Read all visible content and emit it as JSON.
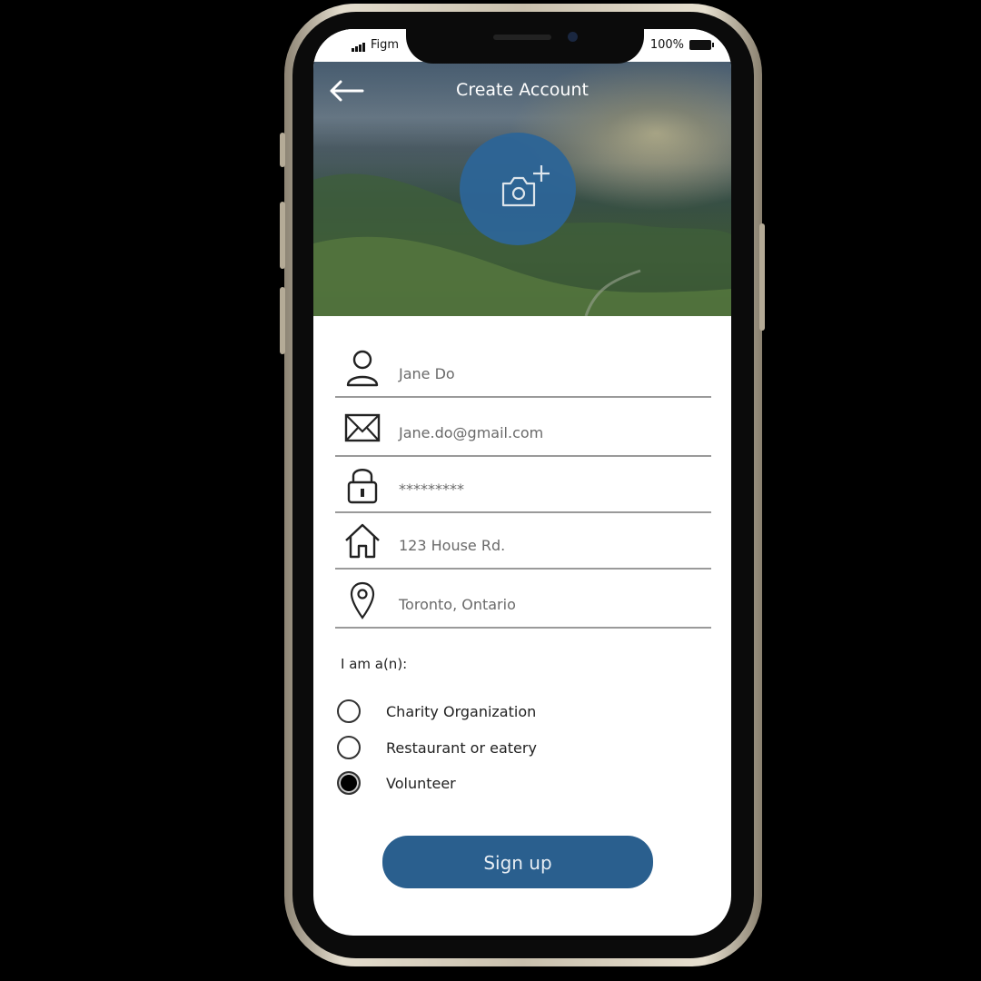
{
  "status_bar": {
    "carrier": "Figm",
    "battery": "100%"
  },
  "header": {
    "title": "Create Account"
  },
  "form": {
    "name": "Jane Do",
    "email": "Jane.do@gmail.com",
    "password": "*********",
    "address": "123 House Rd.",
    "location": "Toronto, Ontario"
  },
  "role": {
    "question": "I am a(n):",
    "options": [
      {
        "label": "Charity Organization",
        "selected": false
      },
      {
        "label": "Restaurant or eatery",
        "selected": false
      },
      {
        "label": "Volunteer",
        "selected": true
      }
    ]
  },
  "signup": {
    "label": "Sign up"
  },
  "colors": {
    "accent": "#2a5f8e",
    "avatar": "#2d6597",
    "background": "#000000"
  }
}
